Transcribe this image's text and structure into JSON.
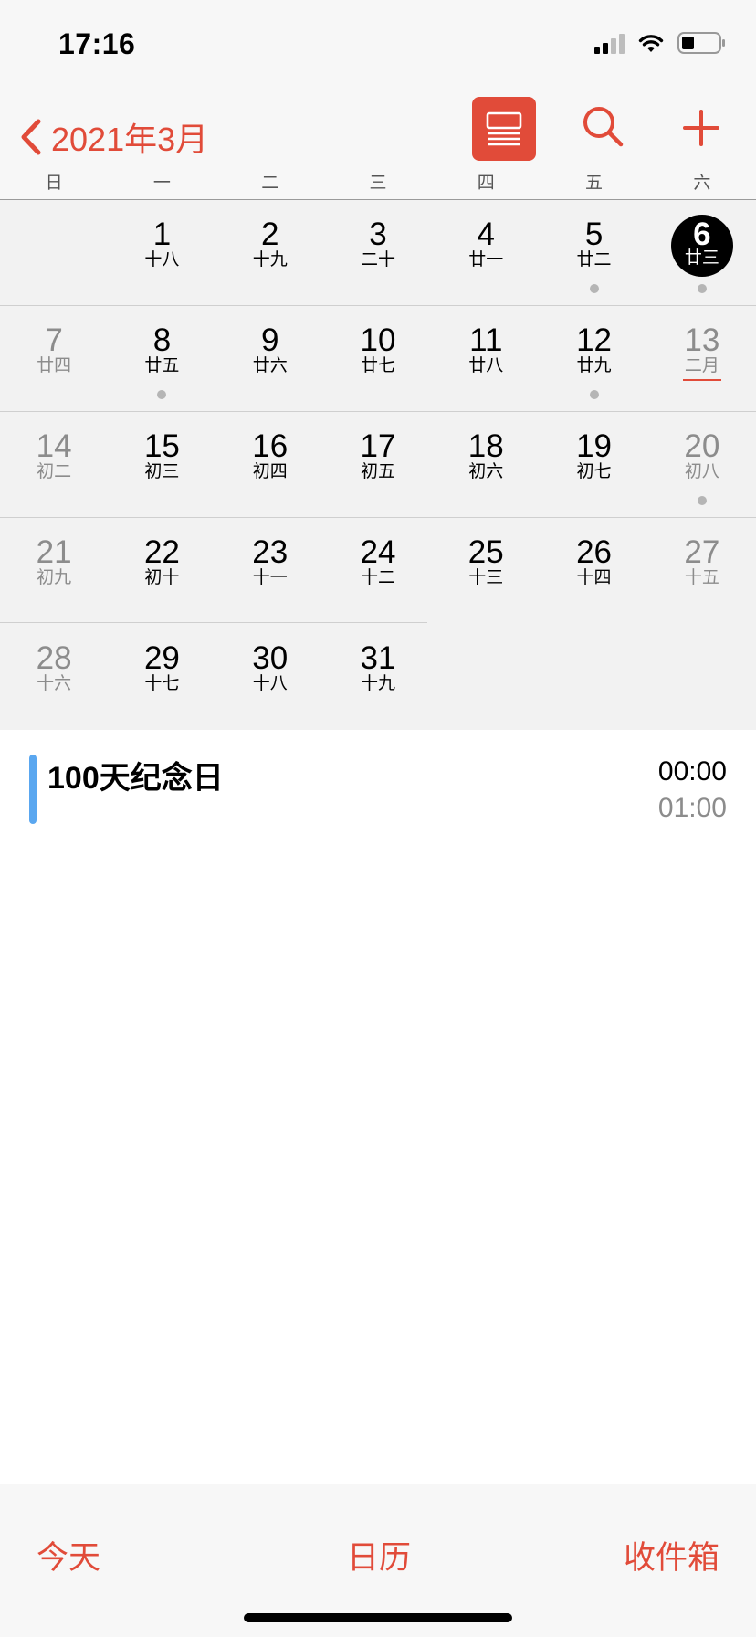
{
  "status_bar": {
    "time": "17:16",
    "icons": [
      "cellular-signal-icon",
      "wifi-icon",
      "battery-icon"
    ]
  },
  "nav": {
    "back_label": "2021年3月",
    "icons": [
      "chevron-left-icon",
      "list-view-icon",
      "search-icon",
      "plus-icon"
    ],
    "accent_color": "#e14b39"
  },
  "weekdays": [
    "日",
    "一",
    "二",
    "三",
    "四",
    "五",
    "六"
  ],
  "weeks": [
    [
      {
        "day": "",
        "lunar": ""
      },
      {
        "day": "1",
        "lunar": "十八"
      },
      {
        "day": "2",
        "lunar": "十九"
      },
      {
        "day": "3",
        "lunar": "二十"
      },
      {
        "day": "4",
        "lunar": "廿一"
      },
      {
        "day": "5",
        "lunar": "廿二",
        "dot": true
      },
      {
        "day": "6",
        "lunar": "廿三",
        "dot": true,
        "today": true
      }
    ],
    [
      {
        "day": "7",
        "lunar": "廿四"
      },
      {
        "day": "8",
        "lunar": "廿五",
        "dot": true
      },
      {
        "day": "9",
        "lunar": "廿六"
      },
      {
        "day": "10",
        "lunar": "廿七"
      },
      {
        "day": "11",
        "lunar": "廿八"
      },
      {
        "day": "12",
        "lunar": "廿九",
        "dot": true
      },
      {
        "day": "13",
        "lunar": "二月",
        "month_start": true
      }
    ],
    [
      {
        "day": "14",
        "lunar": "初二"
      },
      {
        "day": "15",
        "lunar": "初三"
      },
      {
        "day": "16",
        "lunar": "初四"
      },
      {
        "day": "17",
        "lunar": "初五"
      },
      {
        "day": "18",
        "lunar": "初六"
      },
      {
        "day": "19",
        "lunar": "初七"
      },
      {
        "day": "20",
        "lunar": "初八",
        "dot": true
      }
    ],
    [
      {
        "day": "21",
        "lunar": "初九"
      },
      {
        "day": "22",
        "lunar": "初十"
      },
      {
        "day": "23",
        "lunar": "十一"
      },
      {
        "day": "24",
        "lunar": "十二"
      },
      {
        "day": "25",
        "lunar": "十三"
      },
      {
        "day": "26",
        "lunar": "十四"
      },
      {
        "day": "27",
        "lunar": "十五"
      }
    ],
    [
      {
        "day": "28",
        "lunar": "十六"
      },
      {
        "day": "29",
        "lunar": "十七"
      },
      {
        "day": "30",
        "lunar": "十八"
      },
      {
        "day": "31",
        "lunar": "十九"
      },
      {
        "day": "",
        "lunar": ""
      },
      {
        "day": "",
        "lunar": ""
      },
      {
        "day": "",
        "lunar": ""
      }
    ]
  ],
  "event": {
    "title": "100天纪念日",
    "start": "00:00",
    "end": "01:00",
    "color": "#5aa7f0"
  },
  "tabs": {
    "today": "今天",
    "calendars": "日历",
    "inbox": "收件箱"
  }
}
